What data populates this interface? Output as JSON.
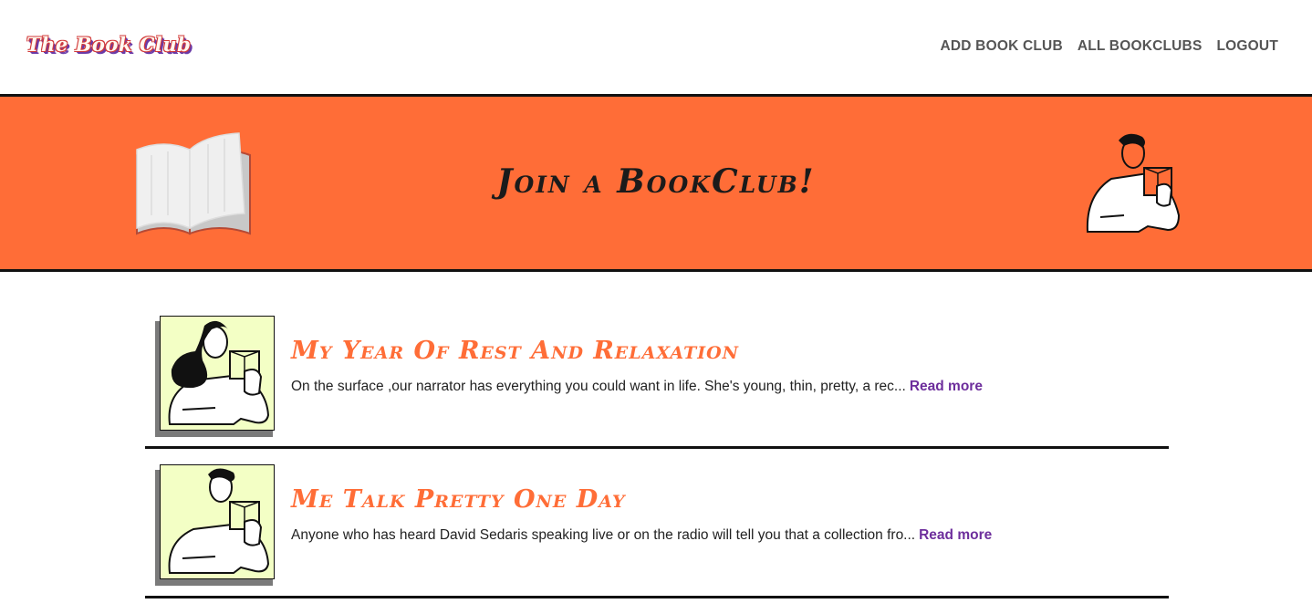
{
  "header": {
    "logo_text": "The Book Club",
    "nav": [
      "ADD BOOK CLUB",
      "ALL BOOKCLUBS",
      "LOGOUT"
    ]
  },
  "hero": {
    "title": "Join a BookClub!",
    "left_icon": "open-book-icon",
    "right_icon": "man-reading-illustration"
  },
  "clubs": [
    {
      "title": "My Year Of Rest And Relaxation",
      "description": "On the surface ,our narrator has everything you could want in life. She's young, thin, pretty, a rec...",
      "link": "Read more",
      "image": "woman-reading-illustration"
    },
    {
      "title": "Me Talk Pretty One Day",
      "description": "Anyone who has heard David Sedaris speaking live or on the radio will tell you that a collection fro...",
      "link": "Read more",
      "image": "man-reading-illustration"
    }
  ],
  "colors": {
    "accent": "#ff6d37",
    "link": "#6d2e9c",
    "thumb_bg": "#f3ffc5"
  }
}
